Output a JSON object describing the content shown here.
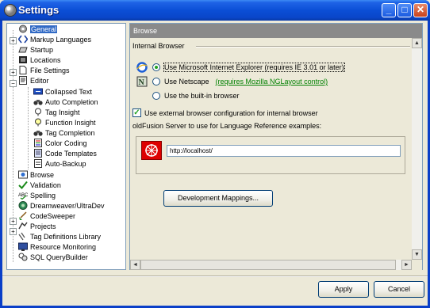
{
  "window": {
    "title": "Settings",
    "buttons": {
      "minimize": "_",
      "maximize": "□",
      "close": "✕"
    }
  },
  "tree": {
    "items": [
      {
        "label": "General",
        "icon": "gear-icon",
        "selected": true
      },
      {
        "label": "Markup Languages",
        "icon": "markup-icon"
      },
      {
        "label": "Startup",
        "icon": "startup-icon"
      },
      {
        "label": "Locations",
        "icon": "locations-icon"
      },
      {
        "label": "File Settings",
        "icon": "file-icon"
      },
      {
        "label": "Editor",
        "icon": "editor-icon"
      },
      {
        "label": "Collapsed Text",
        "icon": "collapsed-text-icon"
      },
      {
        "label": "Auto Completion",
        "icon": "binoculars-icon"
      },
      {
        "label": "Tag Insight",
        "icon": "tag-insight-icon"
      },
      {
        "label": "Function Insight",
        "icon": "function-insight-icon"
      },
      {
        "label": "Tag Completion",
        "icon": "binoculars-icon"
      },
      {
        "label": "Color Coding",
        "icon": "color-coding-icon"
      },
      {
        "label": "Code Templates",
        "icon": "templates-icon"
      },
      {
        "label": "Auto-Backup",
        "icon": "backup-icon"
      },
      {
        "label": "Browse",
        "icon": "browse-icon"
      },
      {
        "label": "Validation",
        "icon": "validation-icon"
      },
      {
        "label": "Spelling",
        "icon": "spelling-icon"
      },
      {
        "label": "Dreamweaver/UltraDev",
        "icon": "dreamweaver-icon"
      },
      {
        "label": "CodeSweeper",
        "icon": "codesweeper-icon"
      },
      {
        "label": "Projects",
        "icon": "projects-icon"
      },
      {
        "label": "Tag Definitions Library",
        "icon": "tag-library-icon"
      },
      {
        "label": "Resource Monitoring",
        "icon": "resource-icon"
      },
      {
        "label": "SQL QueryBuilder",
        "icon": "sql-icon"
      }
    ],
    "expanders": {
      "markup": "+",
      "file": "+",
      "editor": "−",
      "codesweeper": "+",
      "projects": "+"
    }
  },
  "panel": {
    "header": "Browse",
    "section_label": "Internal Browser",
    "options": [
      {
        "label": "Use Microsoft Internet Explorer (requires IE 3.01 or later)",
        "checked": true
      },
      {
        "label": "Use Netscape",
        "link": "(requires Mozilla NGLayout control)",
        "checked": false
      },
      {
        "label": "Use the built-in browser",
        "checked": false
      }
    ],
    "checkbox_label": "Use external browser configuration for internal browser",
    "checkbox_checked": true,
    "server_label": "oldFusion Server to use for Language Reference examples:",
    "server_url": "http://localhost/",
    "dev_mappings_button": "Development Mappings...",
    "scroll": {
      "up": "▲",
      "down": "▼",
      "left": "◄",
      "right": "►"
    }
  },
  "footer": {
    "apply": "Apply",
    "cancel": "Cancel"
  }
}
